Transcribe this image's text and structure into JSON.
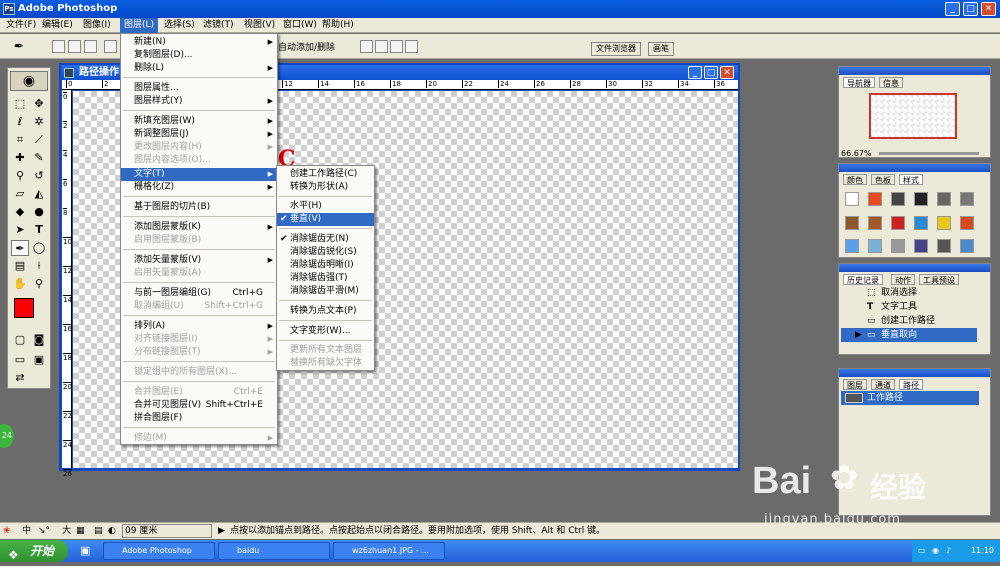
{
  "app": {
    "title": "Adobe Photoshop"
  },
  "menubar": [
    "文件(F)",
    "编辑(E)",
    "图像(I)",
    "图层(L)",
    "选择(S)",
    "滤镜(T)",
    "视图(V)",
    "窗口(W)",
    "帮助(H)"
  ],
  "options_bar": {
    "auto_add_label": "自动添加/删除",
    "tab_file_browser": "文件浏览器",
    "tab_brushes": "画笔"
  },
  "document": {
    "title": "路径操作"
  },
  "ruler_ticks": [
    "0",
    "2",
    "4",
    "6",
    "8",
    "10",
    "12",
    "14",
    "16",
    "18",
    "20",
    "22",
    "24",
    "26",
    "28",
    "30",
    "32",
    "34",
    "36"
  ],
  "ruler_v_ticks": [
    "0",
    "2",
    "4",
    "6",
    "8",
    "10",
    "12",
    "14",
    "16",
    "18",
    "20",
    "22",
    "24",
    "26"
  ],
  "layer_menu": {
    "items": [
      {
        "label": "新建(N)",
        "arrow": "▶"
      },
      {
        "label": "复制图层(D)..."
      },
      {
        "label": "删除(L)",
        "arrow": "▶"
      },
      {
        "label": "图层属性..."
      },
      {
        "label": "图层样式(Y)",
        "arrow": "▶"
      },
      {
        "label": "新填充图层(W)",
        "arrow": "▶"
      },
      {
        "label": "新调整图层(J)",
        "arrow": "▶"
      },
      {
        "label": "更改图层内容(H)",
        "arrow": "▶",
        "disabled": true
      },
      {
        "label": "图层内容选项(O)...",
        "disabled": true
      },
      {
        "label": "文字(T)",
        "arrow": "▶",
        "highlight": true
      },
      {
        "label": "栅格化(Z)",
        "arrow": "▶"
      },
      {
        "label": "基于图层的切片(B)"
      },
      {
        "label": "添加图层蒙版(K)",
        "arrow": "▶"
      },
      {
        "label": "启用图层蒙版(B)",
        "disabled": true
      },
      {
        "label": "添加矢量蒙版(V)",
        "arrow": "▶"
      },
      {
        "label": "启用矢量蒙版(A)",
        "disabled": true
      },
      {
        "label": "与前一图层编组(G)",
        "shortcut": "Ctrl+G"
      },
      {
        "label": "取消编组(U)",
        "shortcut": "Shift+Ctrl+G",
        "disabled": true
      },
      {
        "label": "排列(A)",
        "arrow": "▶"
      },
      {
        "label": "对齐链接图层(I)",
        "arrow": "▶",
        "disabled": true
      },
      {
        "label": "分布链接图层(T)",
        "arrow": "▶",
        "disabled": true
      },
      {
        "label": "锁定组中的所有图层(X)...",
        "disabled": true
      },
      {
        "label": "合并图层(E)",
        "shortcut": "Ctrl+E",
        "disabled": true
      },
      {
        "label": "合并可见图层(V)",
        "shortcut": "Shift+Ctrl+E"
      },
      {
        "label": "拼合图层(F)"
      },
      {
        "label": "修边(M)",
        "arrow": "▶",
        "disabled": true
      }
    ]
  },
  "type_submenu": {
    "items": [
      {
        "label": "创建工作路径(C)"
      },
      {
        "label": "转换为形状(A)"
      },
      {
        "label": "水平(H)"
      },
      {
        "label": "垂直(V)",
        "highlight": true,
        "check": "✔"
      },
      {
        "label": "消除锯齿无(N)",
        "check": "✔"
      },
      {
        "label": "消除锯齿锐化(S)"
      },
      {
        "label": "消除锯齿明晰(I)"
      },
      {
        "label": "消除锯齿强(T)"
      },
      {
        "label": "消除锯齿平滑(M)"
      },
      {
        "label": "转换为点文本(P)"
      },
      {
        "label": "文字变形(W)..."
      },
      {
        "label": "更新所有文本图层",
        "disabled": true
      },
      {
        "label": "替换所有缺欠字体",
        "disabled": true
      }
    ]
  },
  "navigator": {
    "tabs": [
      "导航器",
      "信息"
    ],
    "zoom": "66.67%"
  },
  "swatches": {
    "tabs": [
      "颜色",
      "色板",
      "样式"
    ]
  },
  "history": {
    "tabs": [
      "历史记录",
      "动作",
      "工具预设"
    ],
    "items": [
      "取消选择",
      "文字工具",
      "创建工作路径",
      "垂直取向"
    ]
  },
  "paths": {
    "tabs": [
      "图层",
      "通道",
      "路径"
    ],
    "item": "工作路径"
  },
  "status": {
    "ime": "中",
    "ime2": "大",
    "zoom": "09 厘米",
    "hint": "点按以添加锚点到路径。点按起始点以闭合路径。要用附加选项，使用 Shift、Alt 和 Ctrl 键。"
  },
  "taskbar": {
    "start": "开始",
    "tasks": [
      "Adobe Photoshop",
      "baidu",
      "wz6zhuan1.JPG - ..."
    ],
    "clock": "11:10"
  },
  "watermark": {
    "brand": "Bai",
    "brand2": "经验",
    "url": "jingyan.baidu.com"
  },
  "colors": {
    "accent": "#316ac5",
    "titlebar": "#0347c9",
    "fg_color": "#ff0000",
    "bg_color": "#0000ff"
  }
}
